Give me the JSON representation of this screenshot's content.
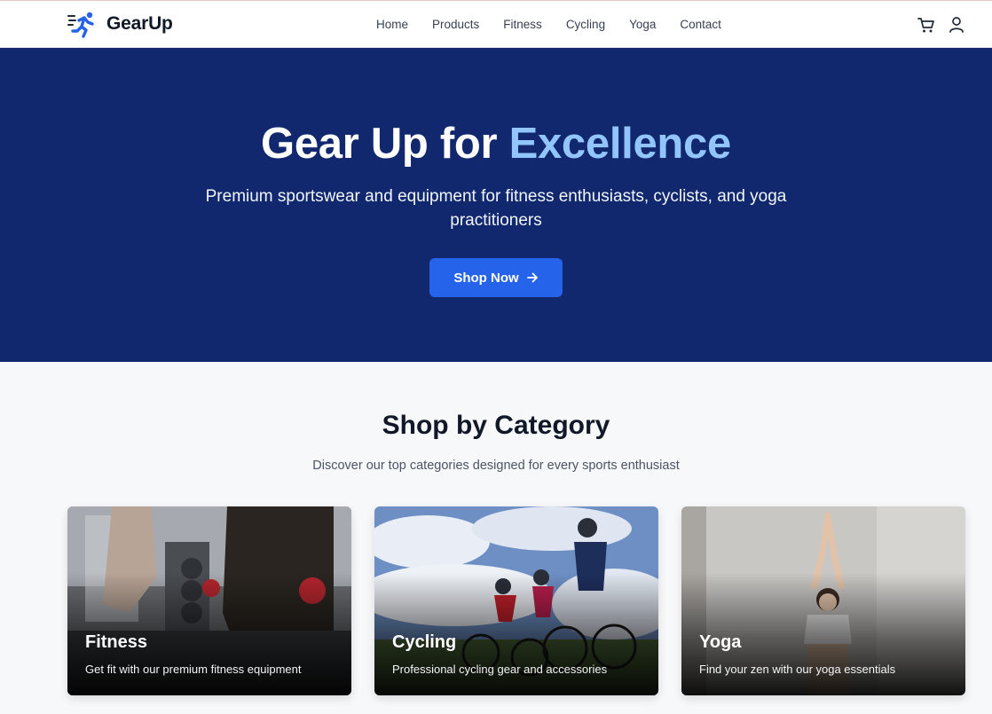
{
  "brand": {
    "name": "GearUp",
    "logo_icon": "runner-icon"
  },
  "nav": {
    "items": [
      "Home",
      "Products",
      "Fitness",
      "Cycling",
      "Yoga",
      "Contact"
    ]
  },
  "header_icons": [
    "cart-icon",
    "user-icon"
  ],
  "hero": {
    "title_start": "Gear Up for ",
    "title_accent": "Excellence",
    "subtitle": "Premium sportswear and equipment for fitness enthusiasts, cyclists, and yoga practitioners",
    "cta": "Shop Now",
    "cta_icon": "arrow-right-icon"
  },
  "categories": {
    "title": "Shop by Category",
    "subtitle": "Discover our top categories designed for every sports enthusiast",
    "items": [
      {
        "title": "Fitness",
        "description": "Get fit with our premium fitness equipment"
      },
      {
        "title": "Cycling",
        "description": "Professional cycling gear and accessories"
      },
      {
        "title": "Yoga",
        "description": "Find your zen with our yoga essentials"
      }
    ]
  },
  "colors": {
    "hero_bg": "#12286e",
    "accent": "#93c5fd",
    "primary": "#2563eb"
  }
}
